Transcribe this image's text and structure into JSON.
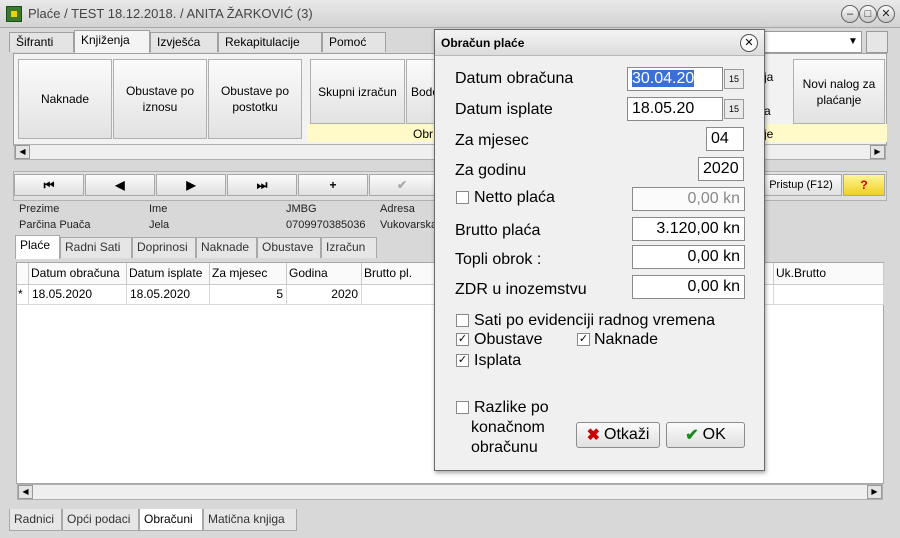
{
  "window": {
    "title": "Plaće / TEST 18.12.2018.  / ANITA ŽARKOVIĆ (3)",
    "minimize": "–",
    "maximize": "□",
    "close": "✕"
  },
  "menu_tabs": [
    "Šifranti",
    "Knjiženja",
    "Izvješća",
    "Rekapitulacije",
    "Pomoć"
  ],
  "ribbon": {
    "buttons_left": [
      "Naknade",
      "Obustave po iznosu",
      "Obustave po postotku"
    ],
    "buttons_group": [
      "Skupni izračun",
      "Bodo"
    ],
    "group_label": "Obr",
    "group_label_right": "je",
    "hidden_partial": "ja",
    "hidden_partial2": "a",
    "right_button": "Novi nalog za plaćanje"
  },
  "combo_arrow": "▼",
  "nav": {
    "first": "⏮",
    "prev": "◀",
    "next": "▶",
    "last": "⏭",
    "add": "+",
    "check": "✔",
    "access": "Pristup (F12)",
    "help": "?"
  },
  "employee": {
    "prezime_label": "Prezime",
    "prezime": "Parčina Puača",
    "ime_label": "Ime",
    "ime": "Jela",
    "jmbg_label": "JMBG",
    "jmbg": "0709970385036",
    "adresa_label": "Adresa",
    "adresa": "Vukovarska"
  },
  "sub_tabs": [
    "Plaće",
    "Radni Sati",
    "Doprinosi",
    "Naknade",
    "Obustave",
    "Izračun"
  ],
  "grid": {
    "headers": [
      "Datum obračuna",
      "Datum isplate",
      "Za mjesec",
      "Godina",
      "Brutto pl.",
      "Uk.Brutto"
    ],
    "row": {
      "marker": "*",
      "datum_obracuna": "18.05.2020",
      "datum_isplate": "18.05.2020",
      "za_mjesec": "5",
      "godina": "2020"
    }
  },
  "bottom_tabs": [
    "Radnici",
    "Opći podaci",
    "Obračuni",
    "Matična knjiga"
  ],
  "dialog": {
    "title": "Obračun plaće",
    "close": "✕",
    "datum_obracuna_label": "Datum obračuna",
    "datum_obracuna": "30.04.20",
    "datum_isplate_label": "Datum isplate",
    "datum_isplate": "18.05.20",
    "za_mjesec_label": "Za mjesec",
    "za_mjesec": "04",
    "za_godinu_label": "Za godinu",
    "za_godinu": "2020",
    "netto_label": "Netto plaća",
    "netto": "0,00 kn",
    "brutto_label": "Brutto plaća",
    "brutto": "3.120,00 kn",
    "topli_label": "Topli obrok :",
    "topli": "0,00 kn",
    "zdr_label": "ZDR u inozemstvu",
    "zdr": "0,00 kn",
    "sati_label": "Sati po evidenciji radnog vremena",
    "obustave_label": "Obustave",
    "naknade_label": "Naknade",
    "isplata_label": "Isplata",
    "razlike_label_1": "Razlike po",
    "razlike_label_2": "konačnom",
    "razlike_label_3": "obračunu",
    "cancel_label": "Otkaži",
    "ok_label": "OK",
    "check": "✓",
    "cal": "15"
  }
}
